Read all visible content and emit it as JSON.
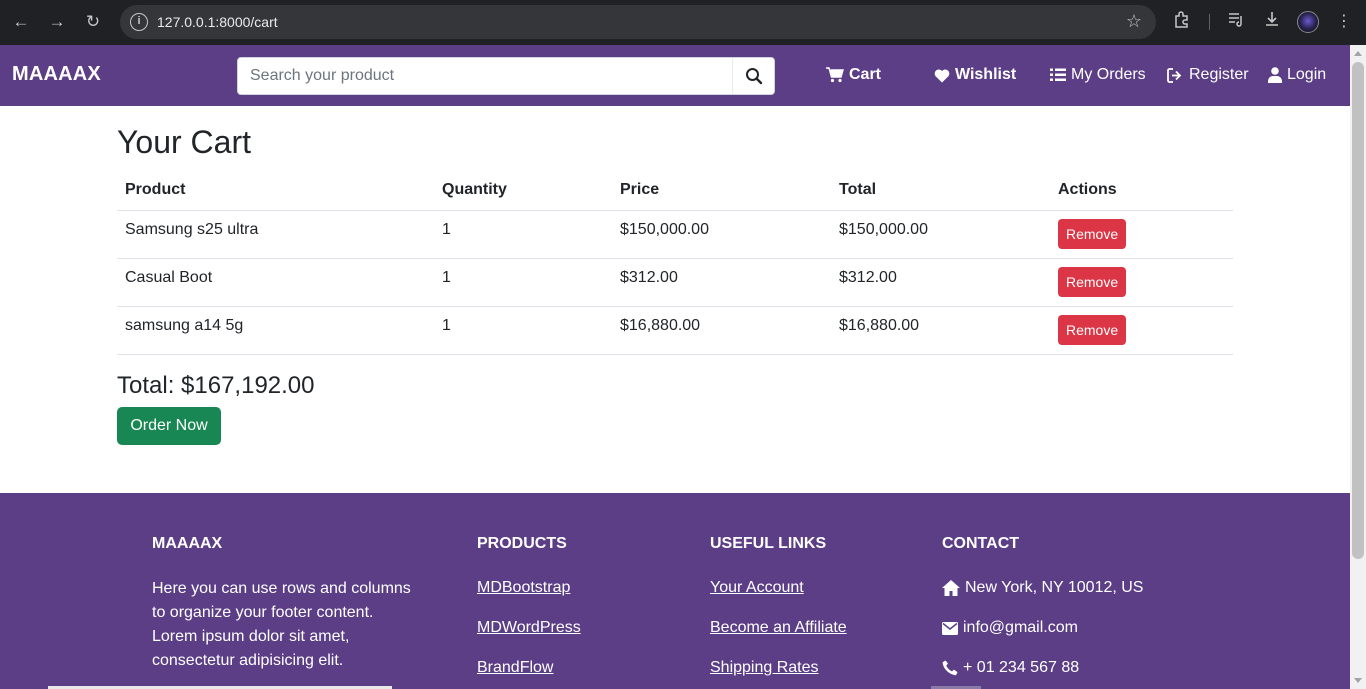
{
  "browser": {
    "url": "127.0.0.1:8000/cart"
  },
  "navbar": {
    "brand": "MAAAAX",
    "search_placeholder": "Search your product",
    "links": {
      "cart": "Cart",
      "wishlist": "Wishlist",
      "orders": "My Orders",
      "register": "Register",
      "login": "Login"
    }
  },
  "cart": {
    "title": "Your Cart",
    "columns": [
      "Product",
      "Quantity",
      "Price",
      "Total",
      "Actions"
    ],
    "rows": [
      {
        "product": "Samsung s25 ultra",
        "quantity": "1",
        "price": "$150,000.00",
        "total": "$150,000.00",
        "action": "Remove"
      },
      {
        "product": "Casual Boot",
        "quantity": "1",
        "price": "$312.00",
        "total": "$312.00",
        "action": "Remove"
      },
      {
        "product": "samsung a14 5g",
        "quantity": "1",
        "price": "$16,880.00",
        "total": "$16,880.00",
        "action": "Remove"
      }
    ],
    "grand_total": "Total: $167,192.00",
    "order_button": "Order Now"
  },
  "footer": {
    "brand_heading": "MAAAAX",
    "brand_text": "Here you can use rows and columns to organize your footer content. Lorem ipsum dolor sit amet, consectetur adipisicing elit.",
    "products_heading": "PRODUCTS",
    "products": [
      "MDBootstrap",
      "MDWordPress",
      "BrandFlow"
    ],
    "links_heading": "USEFUL LINKS",
    "links": [
      "Your Account",
      "Become an Affiliate",
      "Shipping Rates"
    ],
    "contact_heading": "CONTACT",
    "address": "New York, NY 10012, US",
    "email": "info@gmail.com",
    "phone": "+ 01 234 567 88"
  },
  "colors": {
    "brand_purple": "#5c3e86",
    "remove_red": "#dc3545",
    "order_green": "#198754"
  }
}
